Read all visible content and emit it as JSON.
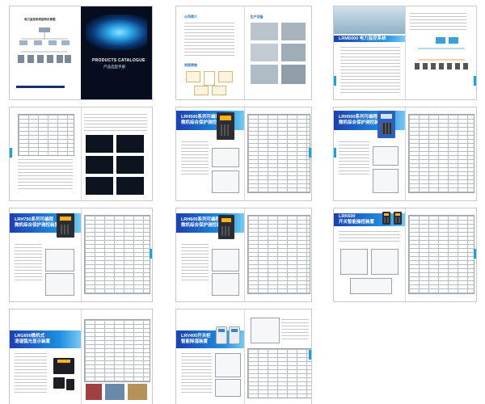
{
  "cover": {
    "title_en": "PRODUCTS CATALOGUE",
    "title_cn": "产品选型手册",
    "diagram_title": "电力监控系统结构示意图"
  },
  "intro_spread": {
    "about_label": "公司简介",
    "production_label": "生产设备",
    "cert_label": "资质荣誉"
  },
  "lrm_spread": {
    "header": "LRM5000 电力监控系统"
  },
  "sections": [
    {
      "header": "LRH500系列可编程\n微机综合保护测控装置"
    },
    {
      "header": "LRH500系列可编程\n微机综合保护测控装置"
    },
    {
      "header": "LRH750系列可编程\n微机综合保护测控装置"
    },
    {
      "header": "LRH600系列可编程\n微机综合保护测控装置"
    },
    {
      "header": "LRK600\n开关智能操控装置"
    },
    {
      "header": "LRG600微机式\n消谐弧光显示装置"
    },
    {
      "header": "LRV400开关柜\n智能除湿装置"
    }
  ]
}
